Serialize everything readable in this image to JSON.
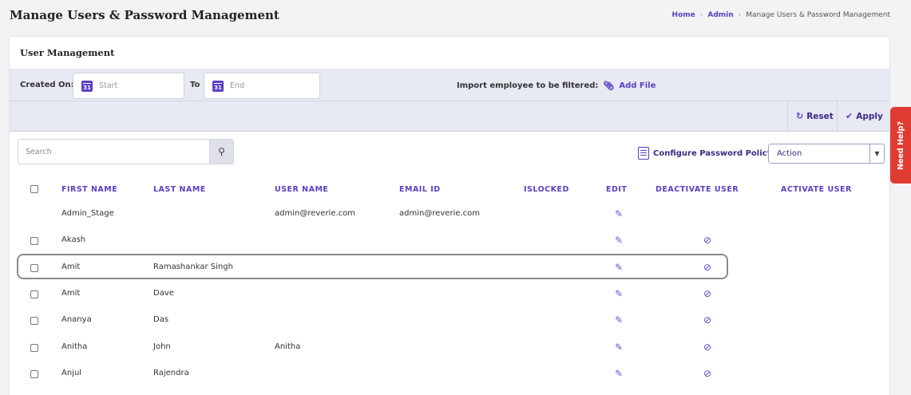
{
  "header": {
    "title": "Manage Users & Password Management",
    "breadcrumb": [
      "Home",
      "Admin",
      "Manage Users & Password Management"
    ]
  },
  "card": {
    "title": "User Management"
  },
  "filters": {
    "created_on_label": "Created On:",
    "start_placeholder": "Start",
    "to_label": "To",
    "end_placeholder": "End",
    "calendar_icon_text": "31",
    "import_label": "Import employee to be filtered:",
    "add_file_label": "Add File",
    "reset_label": "Reset",
    "apply_label": "Apply"
  },
  "toolbar": {
    "search_placeholder": "Search",
    "configure_policy_label": "Configure Password Policy",
    "action_selected": "Action"
  },
  "table": {
    "headers": [
      "FIRST NAME",
      "LAST NAME",
      "USER NAME",
      "EMAIL ID",
      "ISLOCKED",
      "EDIT",
      "DEACTIVATE USER",
      "ACTIVATE USER"
    ],
    "rows": [
      {
        "first": "Admin_Stage",
        "last": "",
        "username": "admin@reverie.com",
        "email": "admin@reverie.com",
        "checkbox": false,
        "deactivate": false
      },
      {
        "first": "Akash",
        "last": "",
        "username": "",
        "email": "",
        "checkbox": true,
        "deactivate": true
      },
      {
        "first": "Amit",
        "last": "Ramashankar Singh",
        "username": "",
        "email": "",
        "checkbox": true,
        "deactivate": true
      },
      {
        "first": "Amit",
        "last": "Dave",
        "username": "",
        "email": "",
        "checkbox": true,
        "deactivate": true
      },
      {
        "first": "Ananya",
        "last": "Das",
        "username": "",
        "email": "",
        "checkbox": true,
        "deactivate": true
      },
      {
        "first": "Anitha",
        "last": "John",
        "username": "Anitha",
        "email": "",
        "checkbox": true,
        "deactivate": true
      },
      {
        "first": "Anjul",
        "last": "Rajendra",
        "username": "",
        "email": "",
        "checkbox": true,
        "deactivate": true
      }
    ]
  },
  "help": {
    "label": "Need Help?"
  },
  "colors": {
    "accent": "#5b3fc4",
    "help": "#e03b33",
    "filter_band": "#e7e9f3"
  }
}
